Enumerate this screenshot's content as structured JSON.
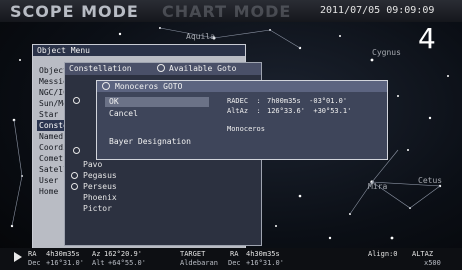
{
  "header": {
    "mode_title": "SCOPE MODE",
    "mode_ghost": "CHART MODE",
    "datetime": "2011/07/05 09:09:09",
    "page_number": "4"
  },
  "sky_labels": [
    "Aquila",
    "Cygnus",
    "Mira",
    "Cetus"
  ],
  "object_menu": {
    "title": "Object Menu",
    "items": [
      "Object",
      "Messier",
      "NGC/IC",
      "Sun/Moon",
      "Star",
      "Constellation",
      "Named",
      "Coordinates",
      "Comet",
      "Satellite",
      "User",
      "Home"
    ],
    "selected_index": 5
  },
  "constellation_menu": {
    "title": "Constellation",
    "available_goto": "Available Goto",
    "items": [
      "Pavo",
      "Pegasus",
      "Perseus",
      "Phoenix",
      "Pictor"
    ]
  },
  "goto_dialog": {
    "title": "Monoceros  GOTO",
    "options": [
      "OK",
      "Cancel",
      "Bayer Designation"
    ],
    "selected_index": 0,
    "radec_label": "RADEC  :",
    "radec_value": "7h00m35s  -03°01.0'",
    "altaz_label": "AltAz  :",
    "altaz_value": "126°33.6'  +30°53.1'",
    "object_name": "Monoceros"
  },
  "status_bar": {
    "ra_label": "RA",
    "ra_value": "4h30m35s",
    "az_label": "Az",
    "az_value": "162°20.9'",
    "dec_label": "Dec",
    "dec_value": "+16°31.0'",
    "alt_label": "Alt",
    "alt_value": "+64°55.0'",
    "target_label": "TARGET",
    "target_ra_label": "RA",
    "target_ra": "4h30m35s",
    "target_name": "Aldebaran",
    "target_dec_label": "Dec",
    "target_dec": "+16°31.0'",
    "align_label": "Align:0",
    "mount_label": "ALTAZ",
    "zoom_label": "x500"
  }
}
